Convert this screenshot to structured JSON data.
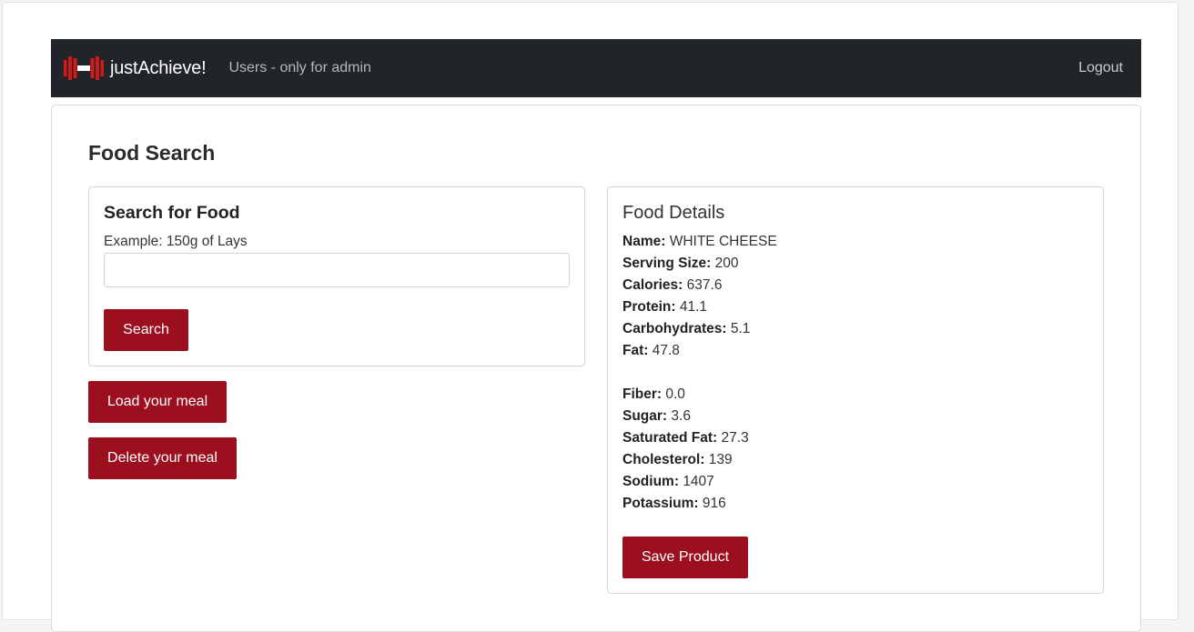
{
  "navbar": {
    "brand": "justAchieve!",
    "brand_icon": "dumbbell-icon",
    "brand_color": "#d11a1a",
    "users_link": "Users - only for admin",
    "logout": "Logout",
    "background": "#212529"
  },
  "page_title": "Food Search",
  "search": {
    "title": "Search for Food",
    "hint": "Example: 150g of Lays",
    "input_value": "",
    "button": "Search"
  },
  "actions": {
    "load_meal": "Load your meal",
    "delete_meal": "Delete your meal"
  },
  "details": {
    "title": "Food Details",
    "name_label": "Name:",
    "name": "WHITE CHEESE",
    "serving_label": "Serving Size:",
    "serving": "200",
    "calories_label": "Calories:",
    "calories": "637.6",
    "protein_label": "Protein:",
    "protein": "41.1",
    "carbs_label": "Carbohydrates:",
    "carbs": "5.1",
    "fat_label": "Fat:",
    "fat": "47.8",
    "fiber_label": "Fiber:",
    "fiber": "0.0",
    "sugar_label": "Sugar:",
    "sugar": "3.6",
    "satfat_label": "Saturated Fat:",
    "satfat": "27.3",
    "cholesterol_label": "Cholesterol:",
    "cholesterol": "139",
    "sodium_label": "Sodium:",
    "sodium": "1407",
    "potassium_label": "Potassium:",
    "potassium": "916",
    "save_button": "Save Product"
  },
  "colors": {
    "accent": "#9b0f1f"
  }
}
